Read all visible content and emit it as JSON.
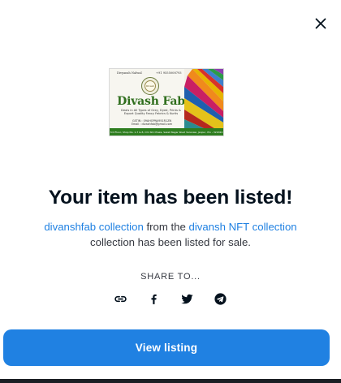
{
  "modal": {
    "title": "Your item has been listed!",
    "description": {
      "item_link": "divanshfab collection",
      "connector": " from the ",
      "collection_link": "divansh NFT collection",
      "suffix": "collection has been listed for sale."
    },
    "share_label": "SHARE TO...",
    "share_buttons": [
      {
        "icon": "link-icon"
      },
      {
        "icon": "facebook-icon"
      },
      {
        "icon": "twitter-icon"
      },
      {
        "icon": "telegram-icon"
      }
    ],
    "view_button_label": "View listing",
    "close_icon": "close-icon",
    "accent_color": "#2081e2"
  },
  "nft_card": {
    "top_left": "Divyansh Nalwal",
    "top_right": "+91 9555008793",
    "emblem": "Divash",
    "brand": "Divash Fab",
    "tagline": "Deals in All Types of Grey, Dyed, Prints & Export Quality Fancy Febrics & Kurtis",
    "gstin": "GSTIN : 09AHOPN4951R1ZN",
    "email": "Email : divashfab@gmail.com",
    "address": "3rd Floor, Shop No. 1-7 & 8, Om Shri Plaza, Saket Nagar Road Varanasi, Janpur, Pin - 322024"
  }
}
